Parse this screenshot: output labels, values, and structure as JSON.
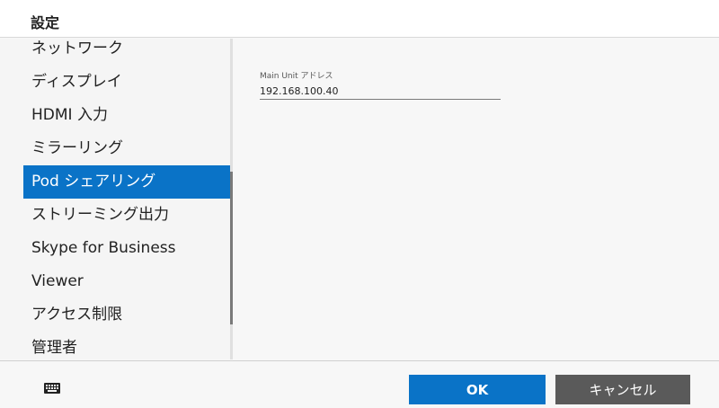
{
  "window": {
    "title": "設定"
  },
  "sidebar": {
    "items": [
      {
        "label": "ネットワーク"
      },
      {
        "label": "ディスプレイ"
      },
      {
        "label": "HDMI 入力"
      },
      {
        "label": "ミラーリング"
      },
      {
        "label": "Pod シェアリング",
        "selected": true
      },
      {
        "label": "ストリーミング出力"
      },
      {
        "label": "Skype for Business"
      },
      {
        "label": "Viewer"
      },
      {
        "label": "アクセス制限"
      },
      {
        "label": "管理者"
      }
    ]
  },
  "main": {
    "field": {
      "label": "Main Unit アドレス",
      "value": "192.168.100.40"
    }
  },
  "footer": {
    "ok_label": "OK",
    "cancel_label": "キャンセル",
    "keyboard_icon": "keyboard-icon"
  },
  "colors": {
    "accent": "#0a73c7",
    "cancel": "#5a5a5a"
  }
}
